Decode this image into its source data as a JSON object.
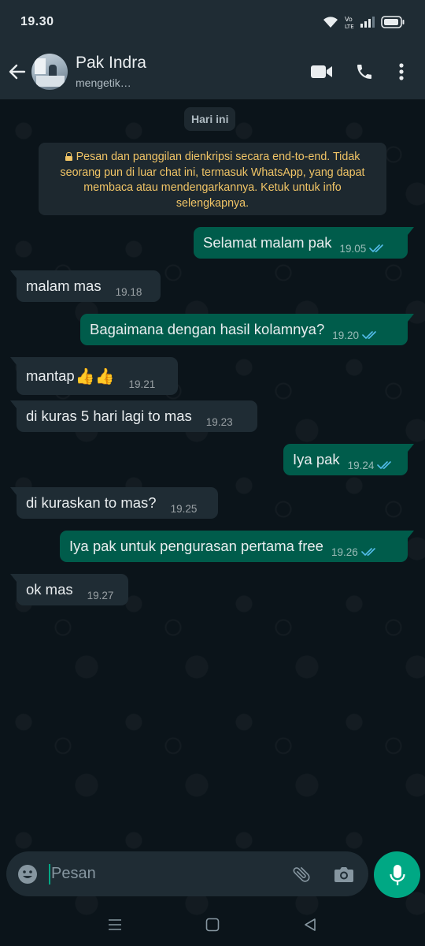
{
  "status_bar": {
    "time": "19.30",
    "icons": [
      "wifi-icon",
      "volte-icon",
      "signal-icon",
      "battery-icon"
    ],
    "volte_text": "Vo LTE"
  },
  "header": {
    "contact_name": "Pak Indra",
    "contact_status": "mengetik…",
    "icons": [
      "back-arrow-icon",
      "video-call-icon",
      "voice-call-icon",
      "more-options-icon"
    ]
  },
  "chat": {
    "date_chip": "Hari ini",
    "encryption_notice": "Pesan dan panggilan dienkripsi secara end-to-end. Tidak seorang pun di luar chat ini, termasuk WhatsApp, yang dapat membaca atau mendengarkannya. Ketuk untuk info selengkapnya.",
    "messages": [
      {
        "direction": "out",
        "text": "Selamat malam pak",
        "time": "19.05",
        "status": "read"
      },
      {
        "direction": "in",
        "text": "malam mas",
        "time": "19.18"
      },
      {
        "direction": "out",
        "text": "Bagaimana dengan hasil kolamnya?",
        "time": "19.20",
        "status": "read"
      },
      {
        "direction": "in",
        "text": "mantap",
        "emoji": "👍👍",
        "time": "19.21"
      },
      {
        "direction": "in",
        "text": "di kuras 5 hari lagi to mas",
        "time": "19.23"
      },
      {
        "direction": "out",
        "text": "Iya pak",
        "time": "19.24",
        "status": "read"
      },
      {
        "direction": "in",
        "text": "di kuraskan to mas?",
        "time": "19.25"
      },
      {
        "direction": "out",
        "text": "Iya pak untuk pengurasan pertama free",
        "time": "19.26",
        "status": "read"
      },
      {
        "direction": "in",
        "text": "ok mas",
        "time": "19.27"
      }
    ]
  },
  "composer": {
    "placeholder": "Pesan",
    "value": "",
    "icons": [
      "emoji-icon",
      "attach-icon",
      "camera-icon",
      "mic-icon"
    ]
  },
  "nav_bar": {
    "icons": [
      "recents-icon",
      "home-icon",
      "back-triangle-icon"
    ]
  },
  "colors": {
    "header_bg": "#1f2c34",
    "chat_bg": "#0b141a",
    "outgoing_bubble": "#005c4b",
    "incoming_bubble": "#1f2c34",
    "accent": "#00a884",
    "read_ticks": "#53bdeb",
    "notice_text": "#f0c466"
  }
}
